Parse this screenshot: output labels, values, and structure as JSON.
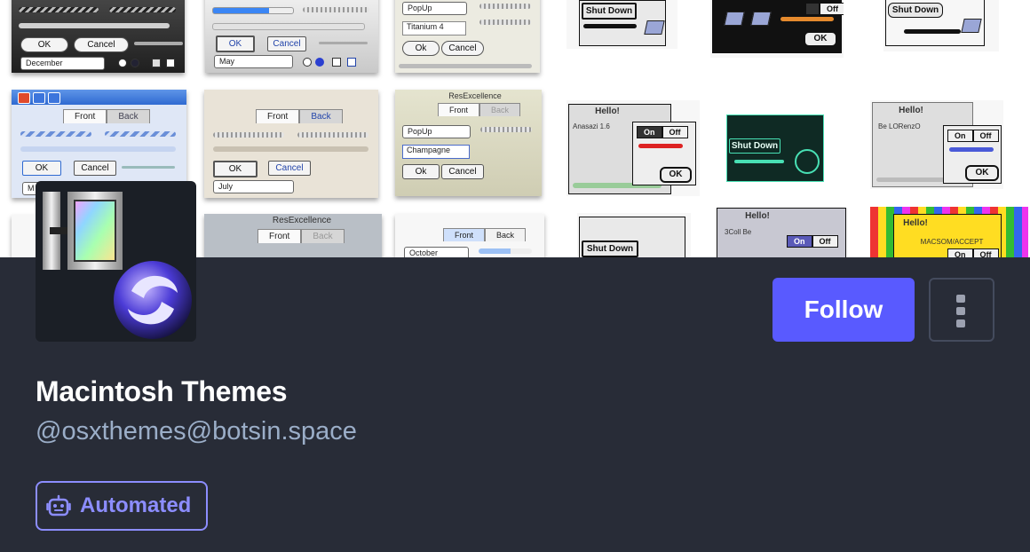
{
  "profile": {
    "display_name": "Macintosh Themes",
    "handle": "@osxthemes@botsin.space",
    "follow_label": "Follow",
    "badge_label": "Automated",
    "accent_color": "#595aff",
    "background_color": "#282c37"
  },
  "icons": {
    "menu": "vertical-ellipsis-icon",
    "badge": "robot-icon"
  },
  "banner": {
    "tile1": {
      "ok": "OK",
      "cancel": "Cancel",
      "popup": "December"
    },
    "tile2": {
      "ok": "OK",
      "cancel": "Cancel",
      "popup": "May"
    },
    "tile3": {
      "popup": "PopUp",
      "text": "Titanium 4",
      "ok": "Ok",
      "cancel": "Cancel"
    },
    "tile4": {
      "shutdown": "Shut Down"
    },
    "tile5": {
      "off": "Off",
      "ok": "OK"
    },
    "tile6": {
      "shutdown": "Shut Down"
    },
    "tile7": {
      "tab_front": "Front",
      "tab_back": "Back",
      "ok": "OK",
      "cancel": "Cancel",
      "popup": "M"
    },
    "tile8": {
      "tab_front": "Front",
      "tab_back": "Back",
      "ok": "OK",
      "cancel": "Cancel",
      "popup": "July"
    },
    "tile9": {
      "title": "ResExcellence",
      "tab_front": "Front",
      "tab_back": "Back",
      "popup": "PopUp",
      "text": "Champagne",
      "ok": "Ok",
      "cancel": "Cancel"
    },
    "tile10": {
      "title": "Hello!",
      "subtitle": "Anasazi 1.6",
      "on": "On",
      "off": "Off",
      "ok": "OK"
    },
    "tile11": {
      "shutdown": "Shut Down"
    },
    "tile12": {
      "title": "Hello!",
      "subtitle": "Be LORenzO",
      "on": "On",
      "off": "Off",
      "ok": "OK"
    },
    "tile13": {
      "title": "ResExcellence",
      "tab_front": "Front",
      "tab_back": "Back"
    },
    "tile14": {
      "tab_front": "Front",
      "tab_back": "Back",
      "popup": "October"
    },
    "tile15": {
      "shutdown": "Shut Down"
    },
    "tile16": {
      "title": "Hello!",
      "subtitle": "3Coll Be",
      "on": "On",
      "off": "Off"
    },
    "tile17": {
      "title": "Hello!",
      "subtitle": "MACSOM/ACCEPT",
      "on": "On",
      "off": "Off"
    }
  }
}
